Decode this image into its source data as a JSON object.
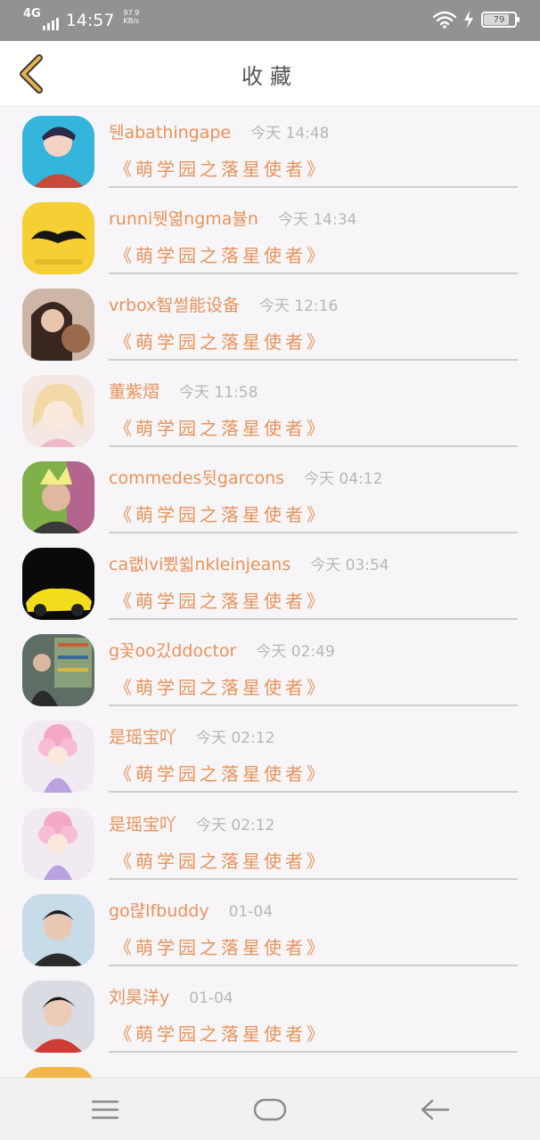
{
  "status_bar": {
    "network": "4G",
    "time": "14:57",
    "speed_value": "97.9",
    "speed_unit": "KB/s",
    "battery": "79",
    "battery_level": 0.79,
    "icons": [
      "signal-icon",
      "wifi-icon",
      "charging-icon",
      "battery-icon"
    ]
  },
  "header": {
    "title": "收藏",
    "back_icon": "chevron-left-icon"
  },
  "colors": {
    "accent": "#e8935b",
    "back_chevron": "#e8b24a",
    "muted_text": "#b7b7b7",
    "status_bar": "#929292"
  },
  "favorites": [
    {
      "user": "뒌abathingape",
      "time": "今天 14:48",
      "title": "《萌学园之落星使者》"
    },
    {
      "user": "runni뒛엶ngma뷸n",
      "time": "今天 14:34",
      "title": "《萌学园之落星使者》"
    },
    {
      "user": "vrbox智썰能设备",
      "time": "今天 12:16",
      "title": "《萌学园之落星使者》"
    },
    {
      "user": "董紫熠",
      "time": "今天 11:58",
      "title": "《萌学园之落星使者》"
    },
    {
      "user": "commedes뒷garcons",
      "time": "今天 04:12",
      "title": "《萌学园之落星使者》"
    },
    {
      "user": "ca랪lvi뾨쓃nkleinjeans",
      "time": "今天 03:54",
      "title": "《萌学园之落星使者》"
    },
    {
      "user": "g꽃oo깄ddoctor",
      "time": "今天 02:49",
      "title": "《萌学园之落星使者》"
    },
    {
      "user": "是瑶宝吖",
      "time": "今天 02:12",
      "title": "《萌学园之落星使者》"
    },
    {
      "user": "是瑶宝吖",
      "time": "今天 02:12",
      "title": "《萌学园之落星使者》"
    },
    {
      "user": "go랺lfbuddy",
      "time": "01-04",
      "title": "《萌学园之落星使者》"
    },
    {
      "user": "刘昊洋y",
      "time": "01-04",
      "title": "《萌学园之落星使者》"
    }
  ],
  "bottom_nav": {
    "icons": [
      "menu-icon",
      "home-icon",
      "back-arrow-icon"
    ]
  }
}
